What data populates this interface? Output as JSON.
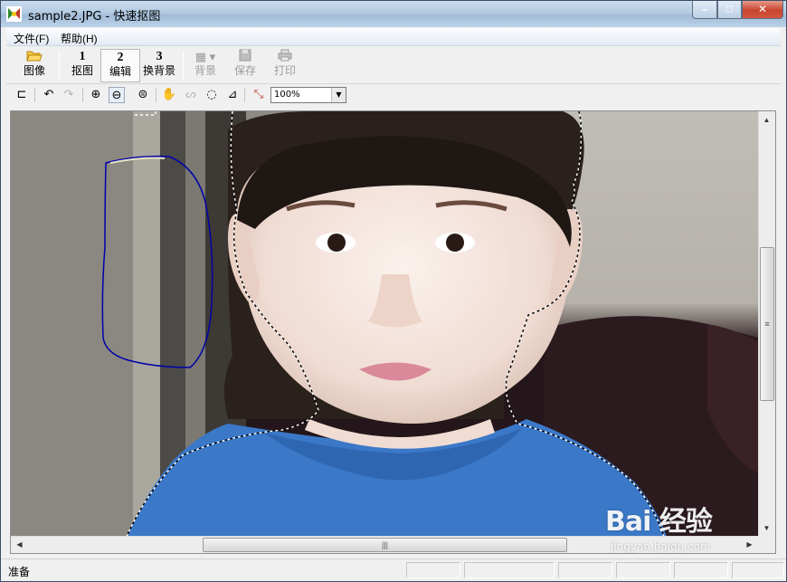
{
  "window": {
    "title": "sample2.JPG - 快速抠图"
  },
  "menu": {
    "items": [
      "文件(F)",
      "帮助(H)"
    ]
  },
  "toolbar": {
    "image": {
      "label": "图像"
    },
    "step1": {
      "num": "1",
      "label": "抠图"
    },
    "step2": {
      "num": "2",
      "label": "编辑"
    },
    "step3": {
      "num": "3",
      "label": "换背景"
    },
    "background": {
      "label": "背景"
    },
    "save": {
      "label": "保存"
    },
    "print": {
      "label": "打印"
    }
  },
  "zoom": {
    "value": "100%"
  },
  "status": {
    "text": "准备"
  },
  "watermark": {
    "logo": "Bai 经验",
    "url": "jingyan.baidu.com"
  },
  "colors": {
    "selection_outline": "#0000aa",
    "titlebar": "#b3cbe2",
    "shirt": "#3b78c8"
  }
}
